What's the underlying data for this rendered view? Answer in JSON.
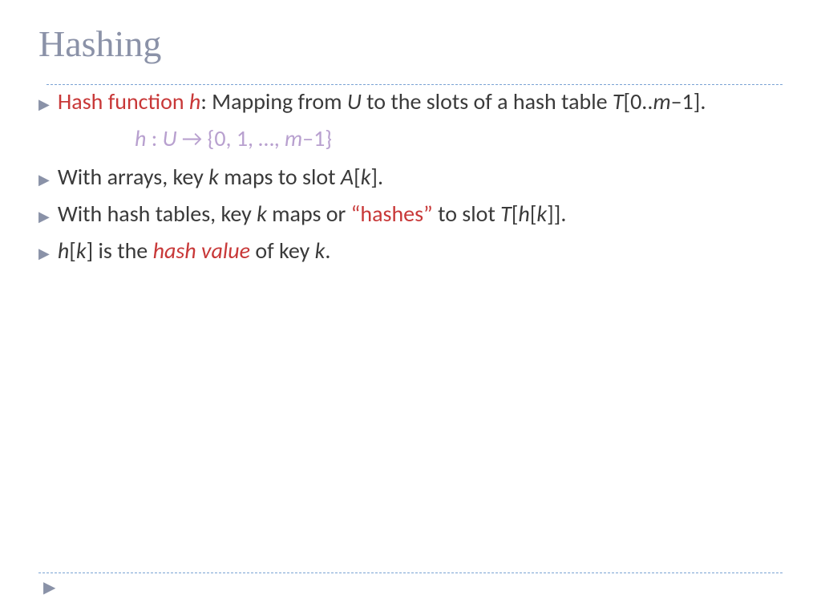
{
  "title": "Hashing",
  "bullets": {
    "b1": {
      "seg1": "Hash function ",
      "seg2": "h",
      "seg3": ": Mapping from ",
      "seg4": "U",
      "seg5": " to the slots of a hash table ",
      "seg6": "T",
      "seg7": "[0..",
      "seg8": "m",
      "seg9": "–1]."
    },
    "fn": {
      "seg1": "h ",
      "seg2": ": ",
      "seg3": "U ",
      "seg4": "→ {0, 1, …, ",
      "seg5": "m",
      "seg6": "–1}"
    },
    "b2": {
      "seg1": "With arrays, key ",
      "seg2": "k",
      "seg3": " maps to slot ",
      "seg4": "A",
      "seg5": "[",
      "seg6": "k",
      "seg7": "]."
    },
    "b3": {
      "seg1": "With hash tables, key ",
      "seg2": "k",
      "seg3": " maps or ",
      "seg4": "“hashes”",
      "seg5": " to slot ",
      "seg6": "T",
      "seg7": "[",
      "seg8": "h",
      "seg9": "[",
      "seg10": "k",
      "seg11": "]]."
    },
    "b4": {
      "seg1": "h",
      "seg2": "[",
      "seg3": "k",
      "seg4": "] is the ",
      "seg5": "hash value",
      "seg6": " of key ",
      "seg7": "k",
      "seg8": "."
    }
  }
}
